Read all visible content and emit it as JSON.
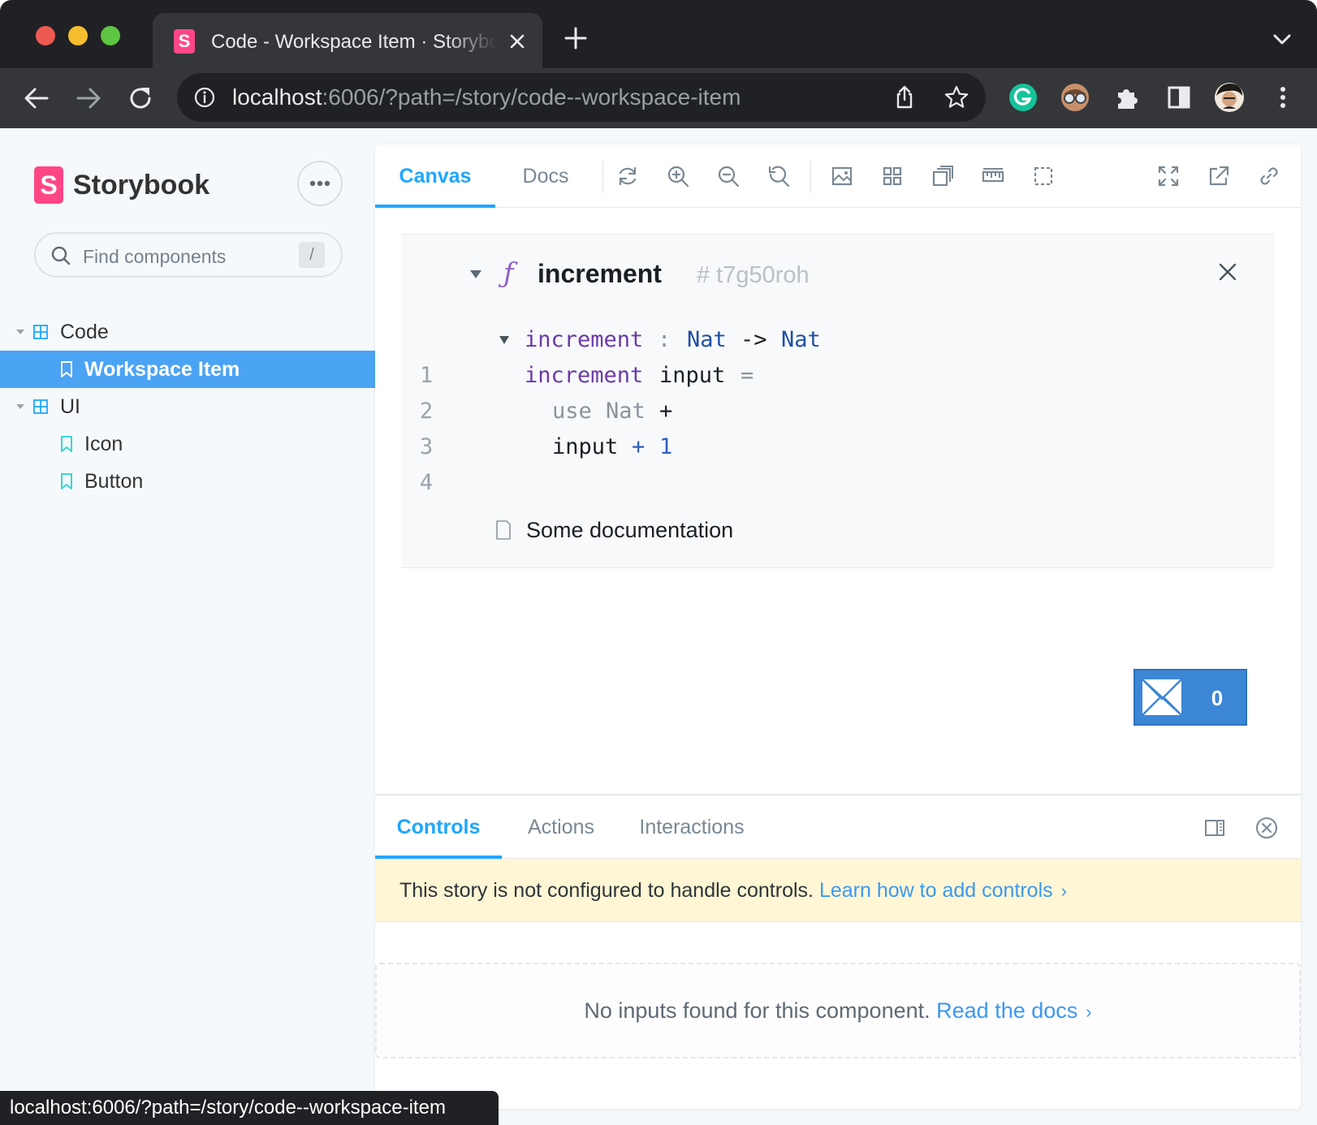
{
  "browser": {
    "tab_title": "Code - Workspace Item · Storybook",
    "url_host": "localhost",
    "url_rest": ":6006/?path=/story/code--workspace-item",
    "status_url": "localhost:6006/?path=/story/code--workspace-item",
    "favicon_letter": "S"
  },
  "sidebar": {
    "brand_letter": "S",
    "brand_name": "Storybook",
    "search_placeholder": "Find components",
    "search_shortcut": "/",
    "tree": [
      {
        "label": "Code",
        "type": "group"
      },
      {
        "label": "Workspace Item",
        "type": "story",
        "selected": true
      },
      {
        "label": "UI",
        "type": "group"
      },
      {
        "label": "Icon",
        "type": "story"
      },
      {
        "label": "Button",
        "type": "story"
      }
    ]
  },
  "preview": {
    "tabs": [
      "Canvas",
      "Docs"
    ],
    "active_tab": "Canvas"
  },
  "workspace_item": {
    "kind_symbol": "ƒ",
    "name": "increment",
    "hash": "# t7g50roh",
    "code_lines": [
      {
        "n": "1",
        "tokens": [
          "increment",
          ":",
          "Nat",
          "->",
          "Nat"
        ]
      },
      {
        "n": "2",
        "tokens": [
          "increment",
          "input",
          "="
        ]
      },
      {
        "n": "3",
        "tokens": [
          "use",
          "Nat",
          "+"
        ]
      },
      {
        "n": "4",
        "tokens": [
          "input",
          "+",
          "1"
        ]
      }
    ],
    "doc_text": "Some documentation"
  },
  "counter_button": {
    "value": "0"
  },
  "addons": {
    "tabs": [
      "Controls",
      "Actions",
      "Interactions"
    ],
    "active_tab": "Controls",
    "warning_text": "This story is not configured to handle controls.",
    "warning_link": "Learn how to add controls",
    "empty_text": "No inputs found for this component.",
    "empty_link": "Read the docs"
  },
  "colors": {
    "accent": "#1ea7fd",
    "selected_row": "#4ba3f4",
    "storybook_pink": "#ff4785",
    "warning_bg": "#fef6d5"
  }
}
